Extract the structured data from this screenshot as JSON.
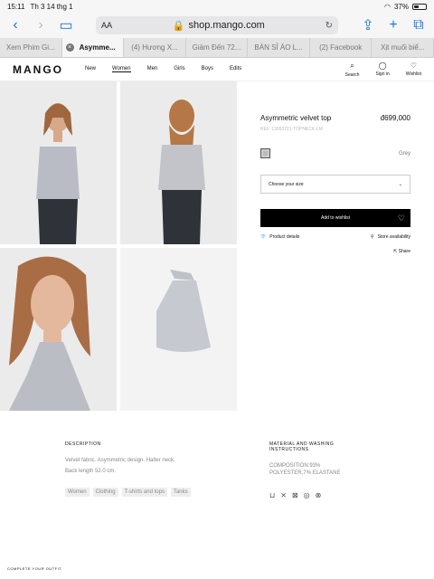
{
  "status": {
    "time": "15:11",
    "date": "Th 3 14 thg 1",
    "battery": "37%"
  },
  "browser": {
    "aa": "AA",
    "url": "shop.mango.com",
    "tabs": [
      "Xem Phim Gi...",
      "Asymme...",
      "(4) Hương X...",
      "Giảm Đến 72...",
      "BÁN SỈ ÁO L...",
      "(2) Facebook",
      "Xịt muối biể..."
    ],
    "active_tab": 1
  },
  "site": {
    "logo": "MANGO",
    "nav": [
      "New",
      "Women",
      "Men",
      "Girls",
      "Boys",
      "Edits"
    ],
    "active_nav": 1,
    "icons": [
      {
        "label": "Search",
        "icon": "search-icon"
      },
      {
        "label": "Sign in",
        "icon": "user-icon"
      },
      {
        "label": "Wishlist",
        "icon": "heart-icon"
      }
    ]
  },
  "product": {
    "title": "Asymmetric velvet top",
    "price": "đ699,000",
    "ref": "REF. 13053721-TOPNECK-LM",
    "color": "Grey",
    "size_placeholder": "Choose your size",
    "wishlist": "Add to wishlist",
    "product_details": "Product details",
    "store": "Store availability",
    "share": "Share"
  },
  "details": {
    "description_heading": "DESCRIPTION",
    "description_lines": [
      "Velvet fabric. Asymmetric design. Halter neck.",
      "Back length 52.0 cm."
    ],
    "tags": [
      "Women",
      "Clothing",
      "T-shirts and tops",
      "Tanks"
    ],
    "material_heading": "MATERIAL AND WASHING INSTRUCTIONS",
    "composition_lines": [
      "COMPOSITION:93%",
      "POLYESTER,7% ELASTANE"
    ]
  },
  "complete": "COMPLETE YOUR OUTFIT",
  "colors": {
    "accent": "#1a73e8",
    "black": "#000000"
  }
}
